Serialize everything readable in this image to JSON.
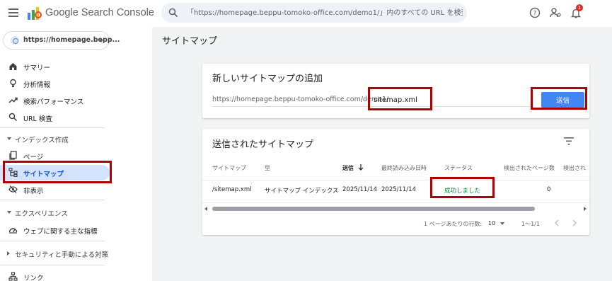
{
  "header": {
    "app_title": "Google Search Console",
    "search_placeholder": "「https://homepage.beppu-tomoko-office.com/demo1/」内のすべての URL を検査",
    "notification_count": "1"
  },
  "sidebar": {
    "property": "https://homepage.bepp...",
    "items": [
      {
        "label": "サマリー",
        "icon": "home-icon"
      },
      {
        "label": "分析情報",
        "icon": "insights-icon"
      },
      {
        "label": "検索パフォーマンス",
        "icon": "trending-icon"
      },
      {
        "label": "URL 検査",
        "icon": "search-icon"
      }
    ],
    "section_index": "インデックス作成",
    "index_items": [
      {
        "label": "ページ",
        "icon": "pages-icon"
      },
      {
        "label": "サイトマップ",
        "icon": "sitemap-icon",
        "active": true
      },
      {
        "label": "非表示",
        "icon": "hidden-icon"
      }
    ],
    "section_experience": "エクスペリエンス",
    "experience_items": [
      {
        "label": "ウェブに関する主な指標",
        "icon": "speed-icon"
      }
    ],
    "section_security": "セキュリティと手動による対策",
    "links_label": "リンク"
  },
  "main": {
    "page_title": "サイトマップ",
    "add_card": {
      "title": "新しいサイトマップの追加",
      "url_prefix": "https://homepage.beppu-tomoko-office.com/demo1/",
      "input_value": "sitemap.xml",
      "submit_label": "送信"
    },
    "submitted_card": {
      "title": "送信されたサイトマップ",
      "columns": [
        "サイトマップ",
        "型",
        "送信",
        "最終読み込み日時",
        "ステータス",
        "検出されたページ数",
        "検出され"
      ],
      "rows": [
        {
          "sitemap": "/sitemap.xml",
          "type": "サイトマップ インデックス",
          "submitted": "2025/11/14",
          "last_read": "2025/11/14",
          "status": "成功しました",
          "pages": "0"
        }
      ],
      "rows_per_page_label": "1 ページあたりの行数:",
      "rows_per_page_value": "10",
      "range": "1〜1/1"
    }
  },
  "colors": {
    "accent": "#4285f4",
    "active_nav_bg": "#d3e3fd",
    "success": "#188038",
    "highlight_box": "#b00000"
  }
}
